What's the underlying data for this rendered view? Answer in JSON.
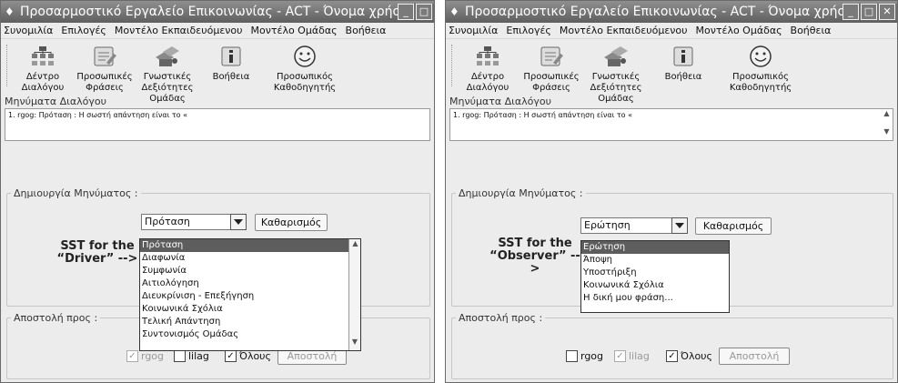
{
  "windowA": {
    "title": "Προσαρμοστικό Εργαλείο Επικοινωνίας - ACT - Όνομα χρήστη : r...",
    "menu": [
      "Συνομιλία",
      "Επιλογές",
      "Μοντέλο Εκπαιδευόμενου",
      "Μοντέλο Ομάδας",
      "Βοήθεια"
    ],
    "tools": [
      {
        "label": "Δέντρο\nΔιαλόγου",
        "icon": "tree-icon"
      },
      {
        "label": "Προσωπικές\nΦράσεις",
        "icon": "phrases-icon"
      },
      {
        "label": "Γνωστικές\nΔεξιότητες\nΟμάδας",
        "icon": "group-skills-icon"
      },
      {
        "label": "Βοήθεια",
        "icon": "help-icon"
      },
      {
        "label": "Προσωπικός\nΚαθοδηγητής",
        "icon": "smiley-icon"
      }
    ],
    "messages_label": "Μηνύματα Διαλόγου",
    "message_line": "1. rgog: Πρόταση : Η σωστή απάντηση είναι το «",
    "compose_legend": "Δημιουργία Μηνύματος :",
    "combo_value": "Πρόταση",
    "clear_button": "Καθαρισμός",
    "sst_line1": "SST for the",
    "sst_line2": "“Driver” -->",
    "dropdown_items": [
      "Πρόταση",
      "Διαφωνία",
      "Συμφωνία",
      "Αιτιολόγηση",
      "Διευκρίνιση - Επεξήγηση",
      "Κοινωνικά Σχόλια",
      "Τελική Απάντηση",
      "Συντονισμός Ομάδας"
    ],
    "send_legend": "Αποστολή προς :",
    "recipients": [
      {
        "label": "rgog",
        "checked": true,
        "disabled": true
      },
      {
        "label": "lilag",
        "checked": false,
        "disabled": false
      },
      {
        "label": "Όλους",
        "checked": true,
        "disabled": false
      }
    ],
    "send_button": "Αποστολή"
  },
  "windowB": {
    "title": "Προσαρμοστικό Εργαλείο Επικοινωνίας - ACT - Όνομα χρήστη : lilag",
    "menu": [
      "Συνομιλία",
      "Επιλογές",
      "Μοντέλο Εκπαιδευόμενου",
      "Μοντέλο Ομάδας",
      "Βοήθεια"
    ],
    "tools": [
      {
        "label": "Δέντρο\nΔιαλόγου",
        "icon": "tree-icon"
      },
      {
        "label": "Προσωπικές\nΦράσεις",
        "icon": "phrases-icon"
      },
      {
        "label": "Γνωστικές\nΔεξιότητες\nΟμάδας",
        "icon": "group-skills-icon"
      },
      {
        "label": "Βοήθεια",
        "icon": "help-icon"
      },
      {
        "label": "Προσωπικός\nΚαθοδηγητής",
        "icon": "smiley-icon"
      }
    ],
    "messages_label": "Μηνύματα Διαλόγου",
    "message_line": "1. rgog: Πρόταση : Η σωστή απάντηση είναι το «",
    "compose_legend": "Δημιουργία Μηνύματος :",
    "combo_value": "Ερώτηση",
    "clear_button": "Καθαρισμός",
    "sst_line1": "SST for the",
    "sst_line2": "“Observer” -->",
    "dropdown_items": [
      "Ερώτηση",
      "Άποψη",
      "Υποστήριξη",
      "Κοινωνικά Σχόλια",
      "Η δική μου φράση..."
    ],
    "send_legend": "Αποστολή προς :",
    "recipients": [
      {
        "label": "rgog",
        "checked": false,
        "disabled": false
      },
      {
        "label": "lilag",
        "checked": true,
        "disabled": true
      },
      {
        "label": "Όλους",
        "checked": true,
        "disabled": false
      }
    ],
    "send_button": "Αποστολή"
  }
}
